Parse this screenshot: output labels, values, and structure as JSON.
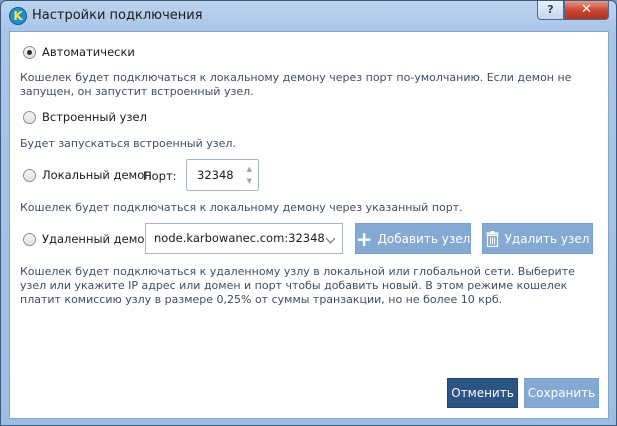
{
  "window": {
    "title": "Настройки подключения",
    "app_icon_letter": "K",
    "help_label": "?",
    "close_label": "✕"
  },
  "options": {
    "auto": {
      "label": "Автоматически",
      "checked": true,
      "description": "Кошелек будет подключаться к локальному демону через порт по-умолчанию. Если демон не запущен, он запустит встроенный узел."
    },
    "embedded": {
      "label": "Встроенный узел",
      "checked": false,
      "description": "Будет запускаться встроенный узел."
    },
    "local": {
      "label": "Локальный демон",
      "checked": false,
      "port_label": "Порт:",
      "port_value": "32348",
      "description": "Кошелек будет подключаться к локальному демону через указанный порт."
    },
    "remote": {
      "label": "Удаленный демон",
      "checked": false,
      "node_value": "node.karbowanec.com:32348",
      "add_button": "Добавить узел",
      "delete_button": "Удалить узел",
      "description": "Кошелек будет подключаться к удаленному узлу в локальной или глобальной сети. Выберите узел или укажите IP адрес или домен и порт чтобы добавить новый. В этом режиме кошелек платит комиссию узлу в размере 0,25% от суммы транзакции, но не более 10 крб."
    }
  },
  "footer": {
    "cancel_label": "Отменить",
    "save_label": "Сохранить"
  },
  "colors": {
    "button_dark": "#2c5484",
    "button_light": "#84a9d3",
    "close": "#c7432e"
  },
  "icons": {
    "add": "plus-icon",
    "delete": "trash-icon",
    "dropdown": "chevron-down-icon",
    "app": "app-logo-icon"
  }
}
